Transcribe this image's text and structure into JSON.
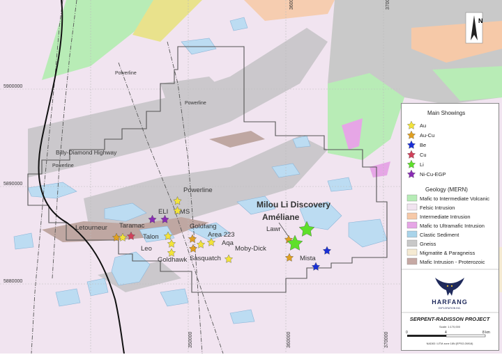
{
  "map": {
    "project_title": "SERPENT-RADISSON PROJECT",
    "company": "HARFANG",
    "company_sub": "EXPLORATION INC.",
    "north_label": "N",
    "scale_text": "Scale: 1:170,000",
    "scale_ticks": [
      "0",
      "4",
      "8 km"
    ],
    "projection": "NAD83 / UTM zone 18N (EPSG:26918)",
    "coords": {
      "x_top": [
        "360000",
        "370000"
      ],
      "x_bottom": [
        "350000",
        "360000",
        "370000"
      ],
      "y_left": [
        "5900000",
        "5890000",
        "5880000"
      ]
    },
    "features": {
      "highway": "Billy-Diamond Highway",
      "powerline": "Powerline"
    },
    "labels": {
      "discovery": "Milou Li Discovery",
      "ameliane": "Améliane",
      "showings": [
        "Powerline",
        "ELI",
        "MMS",
        "Letourneur",
        "Taramac",
        "Talon",
        "Leo",
        "Goldfang",
        "Area 223",
        "Aqa",
        "Moby-Dick",
        "Goldhawk",
        "Sasquatch",
        "Lawr",
        "Mista"
      ]
    },
    "legend": {
      "showings_title": "Main Showings",
      "showings": [
        {
          "label": "Au",
          "color": "#f2e33a"
        },
        {
          "label": "Au-Cu",
          "color": "#e0a020"
        },
        {
          "label": "Be",
          "color": "#1a2fd6"
        },
        {
          "label": "Cu",
          "color": "#d0405a"
        },
        {
          "label": "Li",
          "color": "#5ee02a"
        },
        {
          "label": "Ni-Cu-EGP",
          "color": "#8a2bb5"
        }
      ],
      "geology_title": "Geology (MERN)",
      "geology": [
        {
          "label": "Mafic to Intermediate Volcanic",
          "color": "#b6ecb6"
        },
        {
          "label": "Felsic Intrusion",
          "color": "#f1e4f0"
        },
        {
          "label": "Intermediate Intrusion",
          "color": "#f6c9a8"
        },
        {
          "label": "Mafic to Ultramafic Intrusion",
          "color": "#e6a6e6"
        },
        {
          "label": "Clastic Sediment",
          "color": "#a9d4ea"
        },
        {
          "label": "Gneiss",
          "color": "#c8c8c8"
        },
        {
          "label": "Migmatite & Paragneiss",
          "color": "#f5ead2"
        },
        {
          "label": "Mafic Intrusion - Proterozoic",
          "color": "#c6a9a4"
        }
      ]
    }
  }
}
